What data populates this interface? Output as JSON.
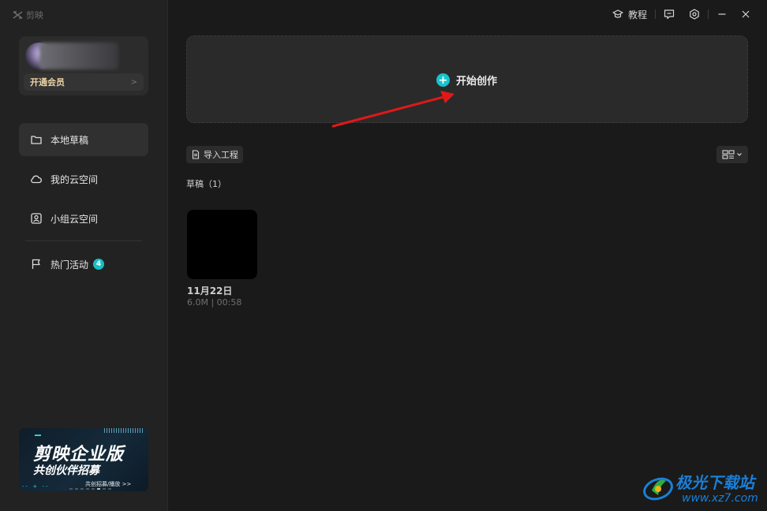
{
  "app": {
    "logo_text": "剪映"
  },
  "topbar": {
    "tutorial_label": "教程",
    "icons": [
      "graduation-cap-icon",
      "feedback-icon",
      "settings-icon",
      "minimize-icon",
      "close-icon"
    ]
  },
  "user": {
    "vip_label": "开通会员",
    "vip_arrow": ">"
  },
  "sidebar": {
    "items": [
      {
        "label": "本地草稿",
        "icon": "folder-icon"
      },
      {
        "label": "我的云空间",
        "icon": "cloud-icon"
      },
      {
        "label": "小组云空间",
        "icon": "team-cloud-icon"
      },
      {
        "label": "热门活动",
        "icon": "flag-icon",
        "badge": "4"
      }
    ]
  },
  "banner": {
    "title": "剪映企业版",
    "subtitle": "共创伙伴招募",
    "cta": "共创招募/播放 >>"
  },
  "main": {
    "start_label": "开始创作",
    "import_label": "导入工程",
    "drafts_title": "草稿（1）",
    "drafts": [
      {
        "name": "11月22日",
        "meta": "6.0M | 00:58"
      }
    ]
  },
  "watermark": {
    "text": "极光下载站",
    "url": "www.xz7.com"
  },
  "colors": {
    "accent": "#17c3cd",
    "vip": "#ecd3a6",
    "arrow": "#e01818"
  }
}
